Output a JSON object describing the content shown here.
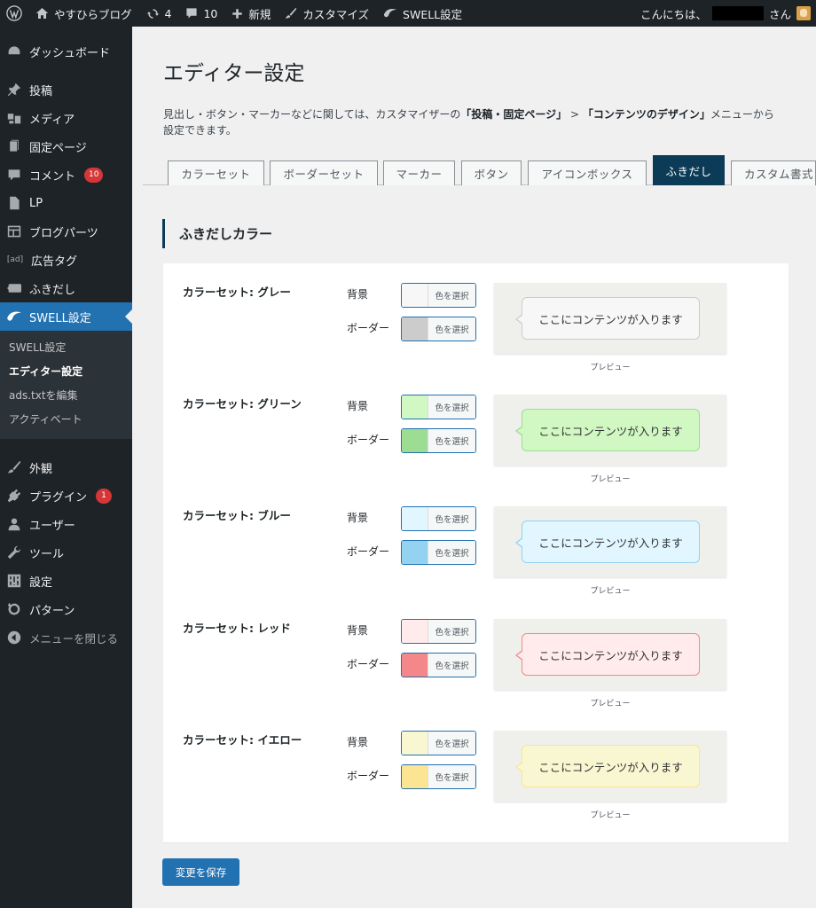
{
  "adminbar": {
    "site_name": "やすひらブログ",
    "updates_count": "4",
    "comments_count": "10",
    "new_label": "新規",
    "customize_label": "カスタマイズ",
    "swell_label": "SWELL設定",
    "greeting_prefix": "こんにちは、",
    "greeting_suffix": "さん"
  },
  "sidebar": {
    "items_top": [
      {
        "label": "ダッシュボード",
        "icon": "dashboard-icon"
      },
      {
        "label": "投稿",
        "icon": "pin-icon"
      },
      {
        "label": "メディア",
        "icon": "media-icon"
      },
      {
        "label": "固定ページ",
        "icon": "page-icon"
      },
      {
        "label": "コメント",
        "icon": "comment-icon",
        "badge": "10"
      },
      {
        "label": "LP",
        "icon": "document-icon"
      },
      {
        "label": "ブログパーツ",
        "icon": "layout-icon"
      },
      {
        "label": "広告タグ",
        "icon": "ad-icon"
      },
      {
        "label": "ふきだし",
        "icon": "bubble-icon"
      },
      {
        "label": "SWELL設定",
        "icon": "swell-icon"
      }
    ],
    "submenu": [
      {
        "label": "SWELL設定"
      },
      {
        "label": "エディター設定"
      },
      {
        "label": "ads.txtを編集"
      },
      {
        "label": "アクティベート"
      }
    ],
    "items_bottom": [
      {
        "label": "外観",
        "icon": "brush-icon"
      },
      {
        "label": "プラグイン",
        "icon": "plugin-icon",
        "badge": "1"
      },
      {
        "label": "ユーザー",
        "icon": "user-icon"
      },
      {
        "label": "ツール",
        "icon": "wrench-icon"
      },
      {
        "label": "設定",
        "icon": "settings-icon"
      },
      {
        "label": "パターン",
        "icon": "pattern-icon"
      }
    ],
    "collapse_label": "メニューを閉じる"
  },
  "page": {
    "title": "エディター設定",
    "desc_prefix": "見出し・ボタン・マーカーなどに関しては、カスタマイザーの",
    "desc_b1": "「投稿・固定ページ」",
    "desc_mid": " > ",
    "desc_b2": "「コンテンツのデザイン」",
    "desc_suffix": "メニューから",
    "desc_line2": "設定できます。",
    "tabs": [
      {
        "label": "カラーセット"
      },
      {
        "label": "ボーダーセット"
      },
      {
        "label": "マーカー"
      },
      {
        "label": "ボタン"
      },
      {
        "label": "アイコンボックス"
      },
      {
        "label": "ふきだし"
      },
      {
        "label": "カスタム書式"
      }
    ],
    "section_title": "ふきだしカラー",
    "bg_label": "背景",
    "border_label": "ボーダー",
    "pick_label": "色を選択",
    "bubble_text": "ここにコンテンツが入ります",
    "preview_label": "プレビュー",
    "save_label": "変更を保存"
  },
  "color_sets": [
    {
      "label": "カラーセット: グレー",
      "bg": "#f7f7f7",
      "border": "#cccccc"
    },
    {
      "label": "カラーセット: グリーン",
      "bg": "#d1f8c2",
      "border": "#9ddd93"
    },
    {
      "label": "カラーセット: ブルー",
      "bg": "#e2f6ff",
      "border": "#93d2f0"
    },
    {
      "label": "カラーセット: レッド",
      "bg": "#ffebeb",
      "border": "#f48789"
    },
    {
      "label": "カラーセット: イエロー",
      "bg": "#f9f7d2",
      "border": "#fbe593"
    }
  ],
  "colors": {
    "accent": "#2271b1",
    "active_tab": "#0c3b57"
  }
}
